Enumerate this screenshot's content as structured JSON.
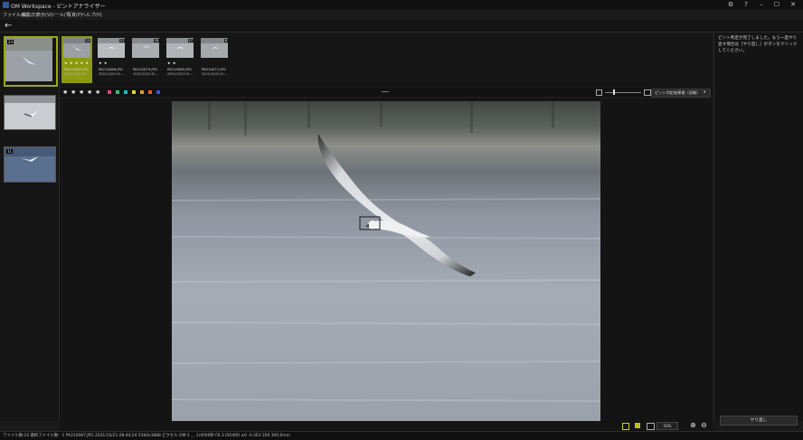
{
  "window": {
    "title": "OM Workspace - ピントアナライザー",
    "controls": [
      "⚙",
      "?",
      "–",
      "☐",
      "✕"
    ]
  },
  "menu": [
    "ファイル(F)",
    "編集(E)",
    "表示(V)",
    "ツール(T)",
    "写真(P)",
    "ヘルプ(H)"
  ],
  "toolbar": {
    "back": "←"
  },
  "left_panel": {
    "thumbnails": [
      {
        "badge": "24",
        "selected": true
      },
      {
        "badge": "",
        "selected": false
      },
      {
        "badge": "11",
        "selected": false
      }
    ]
  },
  "strip": {
    "tiles": [
      {
        "badge": "24",
        "stars": "★ ★ ★ ★ ★",
        "filename": "PA210087.JPG",
        "date": "2021/10/21 8:...",
        "selected": true
      },
      {
        "badge": "23",
        "stars": "★ ★",
        "filename": "PA210086.JPG",
        "date": "2021/10/21 8:...",
        "selected": false
      },
      {
        "badge": "16",
        "stars": "",
        "filename": "PA210079.JPG",
        "date": "2021/10/21 8:...",
        "selected": false
      },
      {
        "badge": "17",
        "stars": "★ ★",
        "filename": "PA210080.JPG",
        "date": "2021/10/21 8:...",
        "selected": false
      },
      {
        "badge": "8",
        "stars": "",
        "filename": "PA210071.JPG",
        "date": "2021/10/21 8:...",
        "selected": false
      }
    ]
  },
  "rating_bar": {
    "stars": [
      "★",
      "★",
      "★",
      "★",
      "★"
    ],
    "colors": [
      "#e0457b",
      "#3bbd7a",
      "#27b4c8",
      "#e3d13a",
      "#e39a2a",
      "#e35a2a",
      "#3a4fd8"
    ],
    "view_select": "ピント判定結果値（詳細）"
  },
  "right_panel": {
    "message": "ピント判定が完了しました。もう一度やり直す場合は［やり直し］ボタンをクリックしてください。",
    "redo_label": "やり直し"
  },
  "bottom_bar": {
    "zoom": "50%"
  },
  "status": {
    "text": "ファイル数:24  選択ファイル数：1  PA210087.JPG  2021/10/21 08:44:24  5184x3888 ピクセル  OM-1  ＿  1/4000秒  F6.3  ISO400  ±0  -0.3EV  200  300.0mm"
  },
  "icons": {
    "app": "app-logo-icon",
    "back": "back-arrow-icon",
    "zoom_in": "zoom-in-icon",
    "zoom_out": "zoom-out-icon"
  }
}
